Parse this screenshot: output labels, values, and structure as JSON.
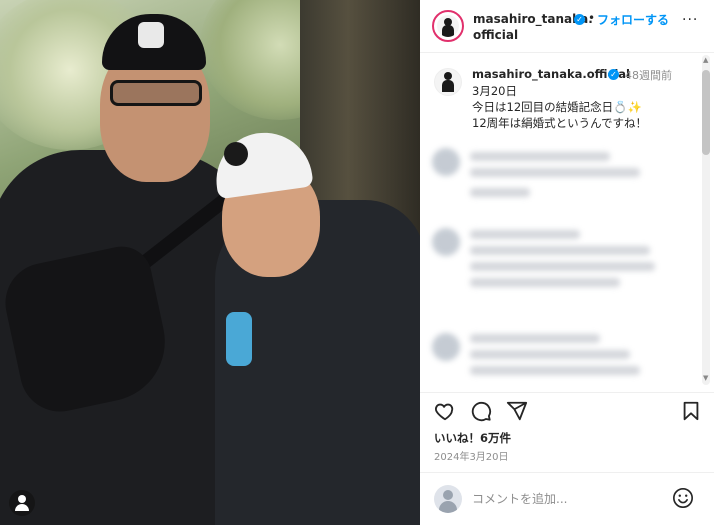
{
  "header": {
    "username_line1": "masahiro_tanaka.",
    "username_line2": "official",
    "separator": "•",
    "follow_label": "フォローする",
    "more_label": "···"
  },
  "caption": {
    "username": "masahiro_tanaka.official",
    "timestamp": "48週間前",
    "date_line": "3月20日",
    "line1": "今日は12回目の結婚記念日💍✨",
    "line2": "12周年は絹婚式というんですね！"
  },
  "post": {
    "likes": "いいね！6万件",
    "date": "2024年3月20日"
  },
  "comment_input": {
    "placeholder": "コメントを追加..."
  },
  "icons": {
    "like": "heart-icon",
    "comment": "comment-icon",
    "share": "share-icon",
    "save": "bookmark-icon",
    "emoji": "emoji-icon",
    "user_tag": "user-tag-icon",
    "verified": "verified-badge-icon"
  },
  "colors": {
    "accent": "#0095f6",
    "story_ring": "#e1306c",
    "text": "#262626",
    "muted": "#8e8e8e"
  }
}
